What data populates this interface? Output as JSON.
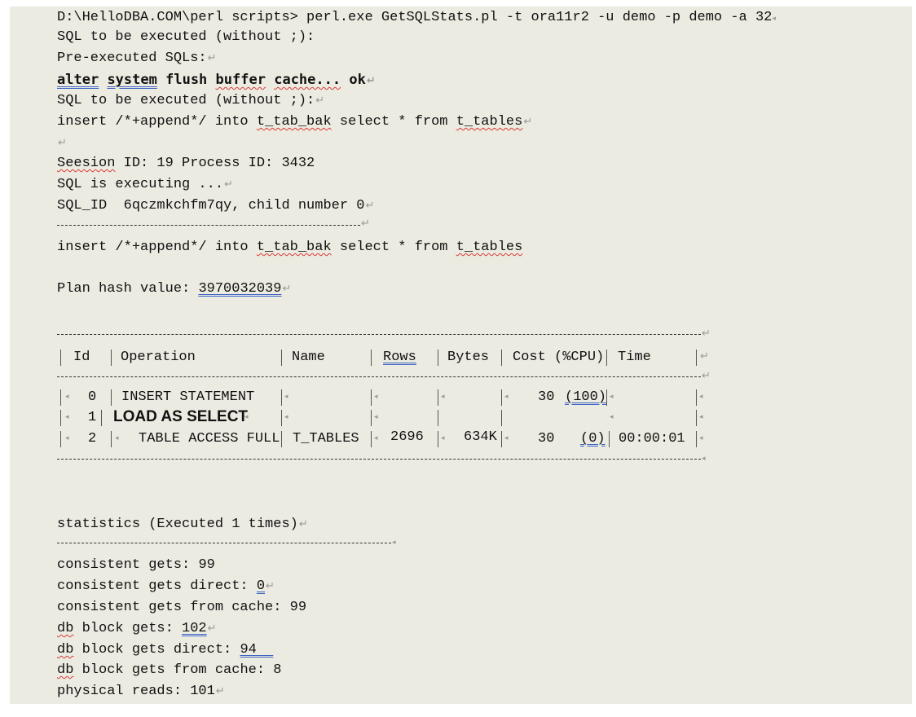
{
  "console": {
    "command_line": "D:\\HelloDBA.COM\\perl scripts> perl.exe GetSQLStats.pl -t ora11r2 -u demo -p demo -a 32",
    "prompt_1": "SQL to be executed (without ;):",
    "pre_executed_label": "Pre-executed SQLs:",
    "pre_sql": {
      "w1": "alter",
      "w2": "system",
      "w3": "flush",
      "w4": "buffer",
      "w5": "cache...",
      "w6": "ok"
    },
    "prompt_2": "SQL to be executed (without ;):",
    "sql_text": {
      "pre": "insert /*+append*/ into ",
      "table1": "t_tab_bak",
      "mid": " select * from ",
      "table2": "t_tables"
    },
    "session_line": {
      "word": "Seesion",
      "rest": " ID: 19 Process ID: 3432"
    },
    "executing": "SQL is executing ...",
    "sql_id_line": "SQL_ID  6qczmkchfm7qy, child number 0",
    "sql_text_2": {
      "pre": "insert /*+append*/ into ",
      "table1": "t_tab_bak",
      "mid": " select * from ",
      "table2": "t_tables"
    },
    "plan_hash": {
      "label": "Plan hash value: ",
      "value": "3970032039"
    }
  },
  "plan_table": {
    "headers": [
      "Id",
      "Operation",
      "Name",
      "Rows",
      "Bytes",
      "Cost (%CPU)",
      "Time"
    ],
    "rows": [
      {
        "id": "0",
        "operation": "INSERT STATEMENT",
        "name": "",
        "rows": "",
        "bytes": "",
        "cost": "30",
        "cpu": "(100)",
        "time": ""
      },
      {
        "id": "1",
        "operation": "LOAD AS SELECT",
        "name": "",
        "rows": "",
        "bytes": "",
        "cost": "",
        "cpu": "",
        "time": ""
      },
      {
        "id": "2",
        "operation": "TABLE ACCESS FULL",
        "name": "T_TABLES",
        "rows": "2696",
        "bytes": "634K",
        "cost": "30",
        "cpu": "(0)",
        "time": "00:00:01"
      }
    ]
  },
  "statistics": {
    "title": "statistics (Executed 1 times)",
    "items": [
      {
        "label": "consistent gets: ",
        "value": "99"
      },
      {
        "label": "consistent gets direct: ",
        "value": "0"
      },
      {
        "label": "consistent gets from cache: ",
        "value": "99"
      },
      {
        "label_prefix": "db",
        "label": " block gets: ",
        "value": "102"
      },
      {
        "label_prefix": "db",
        "label": " block gets direct: ",
        "value": "94"
      },
      {
        "label_prefix": "db",
        "label": " block gets from cache: ",
        "value": "8"
      },
      {
        "label": "physical reads: ",
        "value": "101"
      }
    ]
  },
  "marks": {
    "paragraph": "↵",
    "cell_end": "◂"
  }
}
